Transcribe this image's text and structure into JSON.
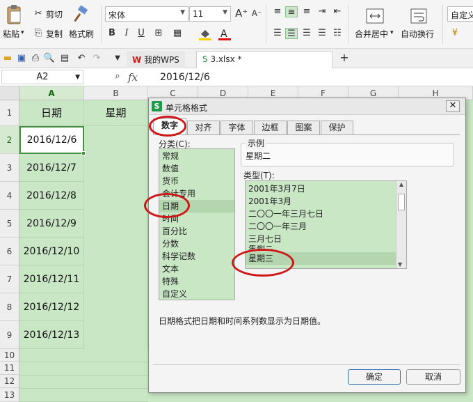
{
  "ribbon": {
    "paste": "粘贴",
    "cut": "剪切",
    "copy": "复制",
    "format_painter": "格式刷",
    "font_name": "宋体",
    "font_size": "11",
    "merge_center": "合并居中",
    "wrap_text": "自动换行",
    "custom_format": "自定义"
  },
  "tabs": {
    "wps": "我的WPS",
    "file": "3.xlsx *"
  },
  "formula": {
    "name_box": "A2",
    "fx": "fx",
    "content": "2016/12/6"
  },
  "sheet": {
    "col_headers": [
      "A",
      "B",
      "C",
      "D",
      "E",
      "F",
      "G",
      "H"
    ],
    "row_headers": [
      "1",
      "2",
      "3",
      "4",
      "5",
      "6",
      "7",
      "8",
      "9",
      "10",
      "11",
      "12",
      "13"
    ],
    "a1": "日期",
    "b1": "星期",
    "dates": [
      "2016/12/6",
      "2016/12/7",
      "2016/12/8",
      "2016/12/9",
      "2016/12/10",
      "2016/12/11",
      "2016/12/12",
      "2016/12/13"
    ]
  },
  "dialog": {
    "title": "单元格格式",
    "tabs": [
      "数字",
      "对齐",
      "字体",
      "边框",
      "图案",
      "保护"
    ],
    "category_label": "分类(C):",
    "categories": [
      "常规",
      "数值",
      "货币",
      "会计专用",
      "日期",
      "时间",
      "百分比",
      "分数",
      "科学记数",
      "文本",
      "特殊",
      "自定义"
    ],
    "sample_label": "示例",
    "sample_value": "星期二",
    "type_label": "类型(T):",
    "types": [
      "2001年3月7日",
      "2001年3月",
      "二〇〇一年三月七日",
      "二〇〇一年三月",
      "三月七日",
      "星期三",
      "星期三"
    ],
    "description": "日期格式把日期和时间系列数显示为日期值。",
    "ok": "确定",
    "cancel": "取消"
  },
  "colors": {
    "cell_green": "#c9e6c5",
    "annotation_red": "#cc1818"
  }
}
